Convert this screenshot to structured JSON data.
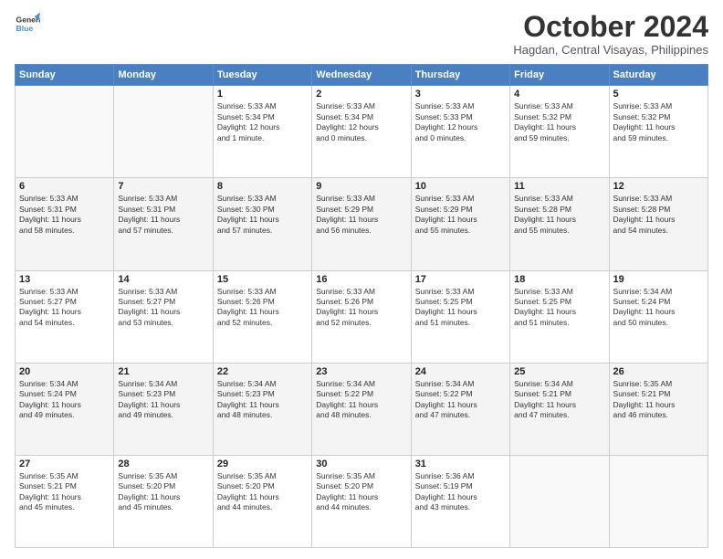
{
  "logo": {
    "line1": "General",
    "line2": "Blue"
  },
  "header": {
    "month": "October 2024",
    "location": "Hagdan, Central Visayas, Philippines"
  },
  "days_of_week": [
    "Sunday",
    "Monday",
    "Tuesday",
    "Wednesday",
    "Thursday",
    "Friday",
    "Saturday"
  ],
  "weeks": [
    [
      {
        "num": "",
        "info": ""
      },
      {
        "num": "",
        "info": ""
      },
      {
        "num": "1",
        "info": "Sunrise: 5:33 AM\nSunset: 5:34 PM\nDaylight: 12 hours\nand 1 minute."
      },
      {
        "num": "2",
        "info": "Sunrise: 5:33 AM\nSunset: 5:34 PM\nDaylight: 12 hours\nand 0 minutes."
      },
      {
        "num": "3",
        "info": "Sunrise: 5:33 AM\nSunset: 5:33 PM\nDaylight: 12 hours\nand 0 minutes."
      },
      {
        "num": "4",
        "info": "Sunrise: 5:33 AM\nSunset: 5:32 PM\nDaylight: 11 hours\nand 59 minutes."
      },
      {
        "num": "5",
        "info": "Sunrise: 5:33 AM\nSunset: 5:32 PM\nDaylight: 11 hours\nand 59 minutes."
      }
    ],
    [
      {
        "num": "6",
        "info": "Sunrise: 5:33 AM\nSunset: 5:31 PM\nDaylight: 11 hours\nand 58 minutes."
      },
      {
        "num": "7",
        "info": "Sunrise: 5:33 AM\nSunset: 5:31 PM\nDaylight: 11 hours\nand 57 minutes."
      },
      {
        "num": "8",
        "info": "Sunrise: 5:33 AM\nSunset: 5:30 PM\nDaylight: 11 hours\nand 57 minutes."
      },
      {
        "num": "9",
        "info": "Sunrise: 5:33 AM\nSunset: 5:29 PM\nDaylight: 11 hours\nand 56 minutes."
      },
      {
        "num": "10",
        "info": "Sunrise: 5:33 AM\nSunset: 5:29 PM\nDaylight: 11 hours\nand 55 minutes."
      },
      {
        "num": "11",
        "info": "Sunrise: 5:33 AM\nSunset: 5:28 PM\nDaylight: 11 hours\nand 55 minutes."
      },
      {
        "num": "12",
        "info": "Sunrise: 5:33 AM\nSunset: 5:28 PM\nDaylight: 11 hours\nand 54 minutes."
      }
    ],
    [
      {
        "num": "13",
        "info": "Sunrise: 5:33 AM\nSunset: 5:27 PM\nDaylight: 11 hours\nand 54 minutes."
      },
      {
        "num": "14",
        "info": "Sunrise: 5:33 AM\nSunset: 5:27 PM\nDaylight: 11 hours\nand 53 minutes."
      },
      {
        "num": "15",
        "info": "Sunrise: 5:33 AM\nSunset: 5:26 PM\nDaylight: 11 hours\nand 52 minutes."
      },
      {
        "num": "16",
        "info": "Sunrise: 5:33 AM\nSunset: 5:26 PM\nDaylight: 11 hours\nand 52 minutes."
      },
      {
        "num": "17",
        "info": "Sunrise: 5:33 AM\nSunset: 5:25 PM\nDaylight: 11 hours\nand 51 minutes."
      },
      {
        "num": "18",
        "info": "Sunrise: 5:33 AM\nSunset: 5:25 PM\nDaylight: 11 hours\nand 51 minutes."
      },
      {
        "num": "19",
        "info": "Sunrise: 5:34 AM\nSunset: 5:24 PM\nDaylight: 11 hours\nand 50 minutes."
      }
    ],
    [
      {
        "num": "20",
        "info": "Sunrise: 5:34 AM\nSunset: 5:24 PM\nDaylight: 11 hours\nand 49 minutes."
      },
      {
        "num": "21",
        "info": "Sunrise: 5:34 AM\nSunset: 5:23 PM\nDaylight: 11 hours\nand 49 minutes."
      },
      {
        "num": "22",
        "info": "Sunrise: 5:34 AM\nSunset: 5:23 PM\nDaylight: 11 hours\nand 48 minutes."
      },
      {
        "num": "23",
        "info": "Sunrise: 5:34 AM\nSunset: 5:22 PM\nDaylight: 11 hours\nand 48 minutes."
      },
      {
        "num": "24",
        "info": "Sunrise: 5:34 AM\nSunset: 5:22 PM\nDaylight: 11 hours\nand 47 minutes."
      },
      {
        "num": "25",
        "info": "Sunrise: 5:34 AM\nSunset: 5:21 PM\nDaylight: 11 hours\nand 47 minutes."
      },
      {
        "num": "26",
        "info": "Sunrise: 5:35 AM\nSunset: 5:21 PM\nDaylight: 11 hours\nand 46 minutes."
      }
    ],
    [
      {
        "num": "27",
        "info": "Sunrise: 5:35 AM\nSunset: 5:21 PM\nDaylight: 11 hours\nand 45 minutes."
      },
      {
        "num": "28",
        "info": "Sunrise: 5:35 AM\nSunset: 5:20 PM\nDaylight: 11 hours\nand 45 minutes."
      },
      {
        "num": "29",
        "info": "Sunrise: 5:35 AM\nSunset: 5:20 PM\nDaylight: 11 hours\nand 44 minutes."
      },
      {
        "num": "30",
        "info": "Sunrise: 5:35 AM\nSunset: 5:20 PM\nDaylight: 11 hours\nand 44 minutes."
      },
      {
        "num": "31",
        "info": "Sunrise: 5:36 AM\nSunset: 5:19 PM\nDaylight: 11 hours\nand 43 minutes."
      },
      {
        "num": "",
        "info": ""
      },
      {
        "num": "",
        "info": ""
      }
    ]
  ]
}
